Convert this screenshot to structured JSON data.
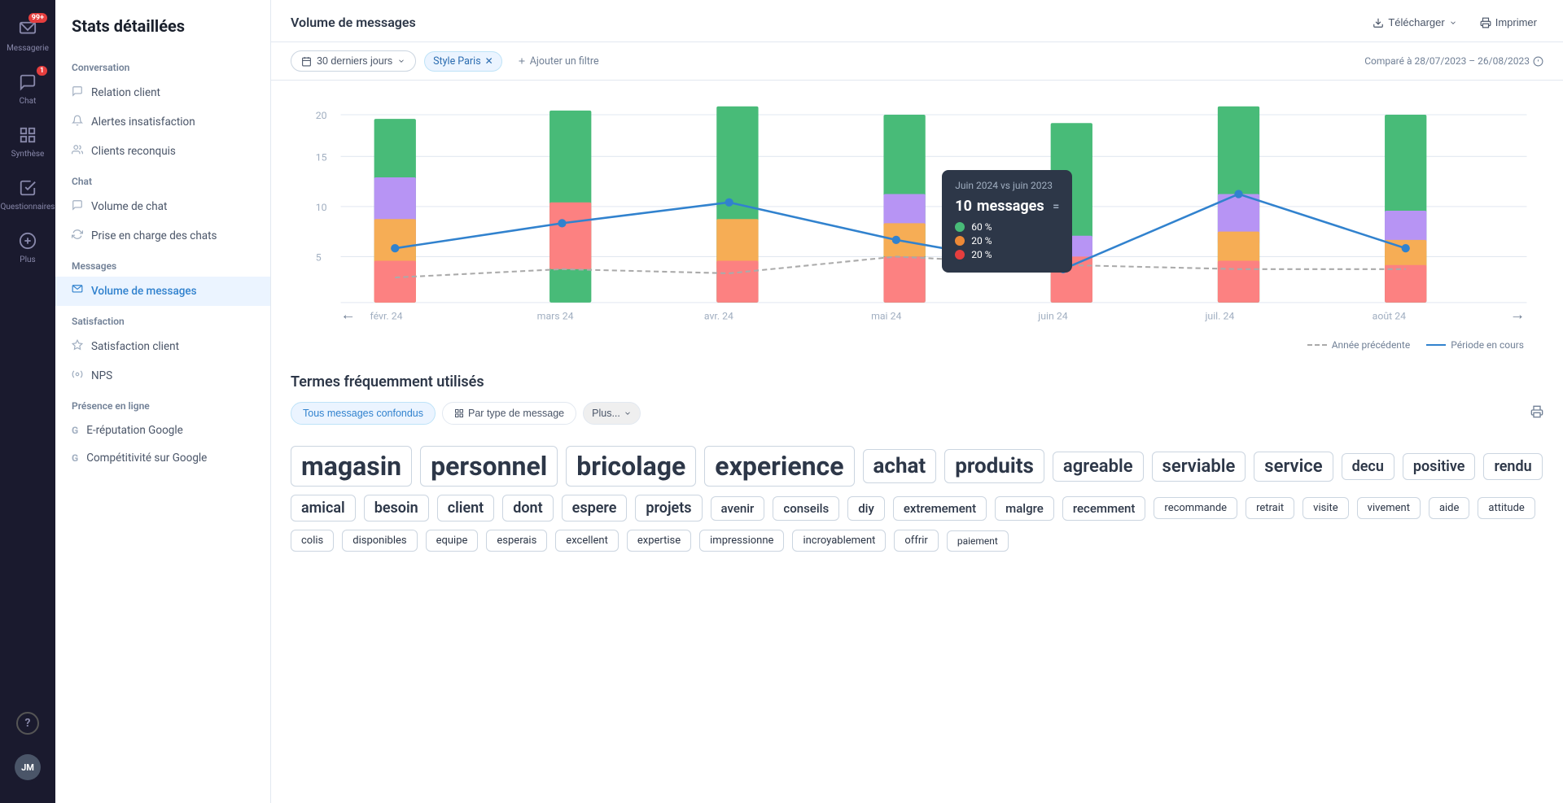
{
  "app": {
    "title": "Stats détaillées"
  },
  "icon_sidebar": {
    "items": [
      {
        "id": "messagerie",
        "label": "Messagerie",
        "icon": "💬",
        "badge": "99+",
        "active": false
      },
      {
        "id": "chat",
        "label": "Chat",
        "icon": "💭",
        "badge": "1",
        "active": false
      },
      {
        "id": "synthese",
        "label": "Synthèse",
        "icon": "⊞",
        "badge": null,
        "active": false
      },
      {
        "id": "questionnaires",
        "label": "Questionnaires",
        "icon": "📋",
        "badge": null,
        "active": false
      },
      {
        "id": "plus",
        "label": "Plus",
        "icon": "⊕",
        "badge": null,
        "active": false
      }
    ],
    "avatar": "JM",
    "help_icon": "?",
    "settings_icon": "⚙"
  },
  "nav_sidebar": {
    "title": "Stats détaillées",
    "sections": [
      {
        "label": "Conversation",
        "items": [
          {
            "id": "relation-client",
            "label": "Relation client",
            "icon": "💬",
            "active": false
          },
          {
            "id": "alertes",
            "label": "Alertes insatisfaction",
            "icon": "🔔",
            "active": false
          },
          {
            "id": "clients",
            "label": "Clients reconquis",
            "icon": "👥",
            "active": false
          }
        ]
      },
      {
        "label": "Chat",
        "items": [
          {
            "id": "volume-chat",
            "label": "Volume de chat",
            "icon": "💬",
            "active": false
          },
          {
            "id": "prise-charge",
            "label": "Prise en charge des chats",
            "icon": "🔄",
            "active": false
          }
        ]
      },
      {
        "label": "Messages",
        "items": [
          {
            "id": "volume-messages",
            "label": "Volume de messages",
            "icon": "✉",
            "active": true
          }
        ]
      },
      {
        "label": "Satisfaction",
        "items": [
          {
            "id": "satisfaction-client",
            "label": "Satisfaction client",
            "icon": "⭐",
            "active": false
          },
          {
            "id": "nps",
            "label": "NPS",
            "icon": "⚙",
            "active": false
          }
        ]
      },
      {
        "label": "Présence en ligne",
        "items": [
          {
            "id": "e-reputation",
            "label": "E-réputation Google",
            "icon": "G",
            "active": false
          },
          {
            "id": "competitivite",
            "label": "Compétitivité sur Google",
            "icon": "G",
            "active": false
          }
        ]
      }
    ]
  },
  "topbar": {
    "title": "Volume de messages",
    "download_label": "Télécharger",
    "print_label": "Imprimer"
  },
  "filters": {
    "date_range": "30 derniers jours",
    "active_filter": "Style Paris",
    "add_filter": "Ajouter un filtre",
    "compared_label": "Comparé à 28/07/2023 – 26/08/2023"
  },
  "chart": {
    "y_labels": [
      "20",
      "15",
      "10",
      "5"
    ],
    "x_labels": [
      "févr. 24",
      "mars 24",
      "avr. 24",
      "mai 24",
      "juin 24",
      "juil. 24",
      "août 24"
    ],
    "tooltip": {
      "title": "Juin 2024 vs juin 2023",
      "messages_count": "10",
      "messages_label": "messages",
      "rows": [
        {
          "color": "#48bb78",
          "pct": "60 %"
        },
        {
          "color": "#ed8936",
          "pct": "20 %"
        },
        {
          "color": "#e53e3e",
          "pct": "20 %"
        }
      ]
    },
    "legend": {
      "previous_label": "Année précédente",
      "current_label": "Période en cours"
    }
  },
  "terms": {
    "title": "Termes fréquemment utilisés",
    "tabs": [
      {
        "id": "tous",
        "label": "Tous messages confondus",
        "active": true
      },
      {
        "id": "type",
        "label": "Par type de message",
        "active": false
      },
      {
        "id": "plus",
        "label": "Plus...",
        "active": false
      }
    ],
    "words": [
      {
        "text": "magasin",
        "size": "xl"
      },
      {
        "text": "personnel",
        "size": "xl"
      },
      {
        "text": "bricolage",
        "size": "xl"
      },
      {
        "text": "experience",
        "size": "xl"
      },
      {
        "text": "achat",
        "size": "lg"
      },
      {
        "text": "produits",
        "size": "lg"
      },
      {
        "text": "agreable",
        "size": "md"
      },
      {
        "text": "serviable",
        "size": "md"
      },
      {
        "text": "service",
        "size": "md"
      },
      {
        "text": "decu",
        "size": "sm"
      },
      {
        "text": "positive",
        "size": "sm"
      },
      {
        "text": "rendu",
        "size": "sm"
      },
      {
        "text": "amical",
        "size": "sm"
      },
      {
        "text": "besoin",
        "size": "sm"
      },
      {
        "text": "client",
        "size": "sm"
      },
      {
        "text": "dont",
        "size": "sm"
      },
      {
        "text": "espere",
        "size": "sm"
      },
      {
        "text": "projets",
        "size": "sm"
      },
      {
        "text": "avenir",
        "size": "xs"
      },
      {
        "text": "conseils",
        "size": "xs"
      },
      {
        "text": "diy",
        "size": "xs"
      },
      {
        "text": "extremement",
        "size": "xs"
      },
      {
        "text": "malgre",
        "size": "xs"
      },
      {
        "text": "recemment",
        "size": "xs"
      },
      {
        "text": "recommande",
        "size": "xxs"
      },
      {
        "text": "retrait",
        "size": "xxs"
      },
      {
        "text": "visite",
        "size": "xxs"
      },
      {
        "text": "vivement",
        "size": "xxs"
      },
      {
        "text": "aide",
        "size": "xxs"
      },
      {
        "text": "attitude",
        "size": "xxs"
      },
      {
        "text": "colis",
        "size": "xxs"
      },
      {
        "text": "disponibles",
        "size": "xxs"
      },
      {
        "text": "equipe",
        "size": "xxs"
      },
      {
        "text": "esperais",
        "size": "xxs"
      },
      {
        "text": "excellent",
        "size": "xxs"
      },
      {
        "text": "expertise",
        "size": "xxs"
      },
      {
        "text": "impressionne",
        "size": "xxs"
      },
      {
        "text": "incroyablement",
        "size": "xxs"
      },
      {
        "text": "offrir",
        "size": "xxs"
      },
      {
        "text": "paiement",
        "size": "xxxs"
      }
    ]
  }
}
